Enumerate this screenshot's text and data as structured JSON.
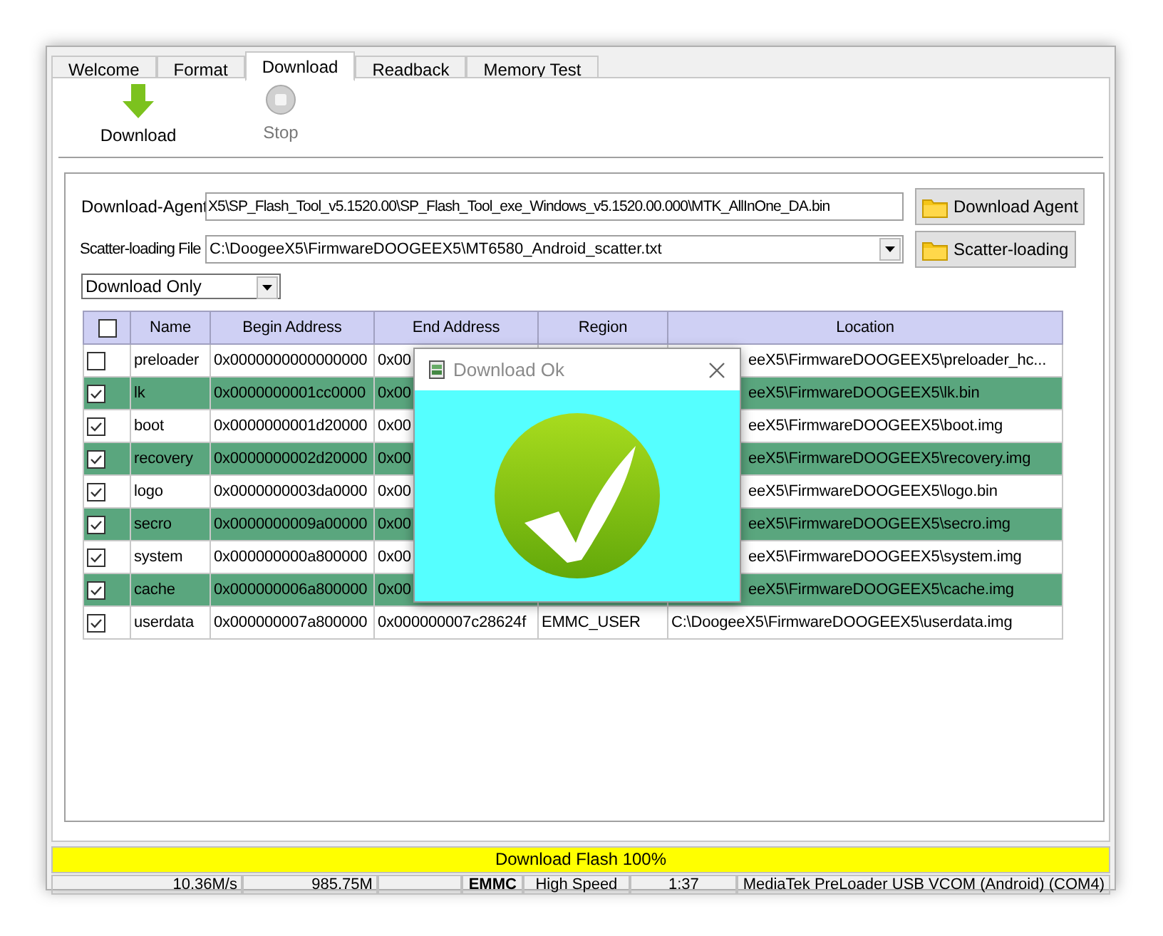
{
  "tabs": [
    {
      "label": "Welcome",
      "selected": false
    },
    {
      "label": "Format",
      "selected": false
    },
    {
      "label": "Download",
      "selected": true
    },
    {
      "label": "Readback",
      "selected": false
    },
    {
      "label": "Memory Test",
      "selected": false
    }
  ],
  "toolbar": [
    {
      "label": "Download",
      "disabled": false,
      "kind": "download"
    },
    {
      "label": "Stop",
      "disabled": true,
      "kind": "stop"
    }
  ],
  "download_agent": {
    "label": "Download-Agent",
    "value": "X5\\SP_Flash_Tool_v5.1520.00\\SP_Flash_Tool_exe_Windows_v5.1520.00.000\\MTK_AllInOne_DA.bin",
    "button": "Download Agent"
  },
  "scatter_file": {
    "label": "Scatter-loading File",
    "value": "C:\\DoogeeX5\\FirmwareDOOGEEX5\\MT6580_Android_scatter.txt",
    "button": "Scatter-loading"
  },
  "mode": {
    "value": "Download Only"
  },
  "table": {
    "header_checked": false,
    "columns": [
      "Name",
      "Begin Address",
      "End Address",
      "Region",
      "Location"
    ],
    "rows": [
      {
        "checked": false,
        "name": "preloader",
        "begin": "0x0000000000000000",
        "end": "0x00",
        "location": "eeX5\\FirmwareDOOGEEX5\\preloader_hc..."
      },
      {
        "checked": true,
        "name": "lk",
        "begin": "0x0000000001cc0000",
        "end": "0x00",
        "location": "eeX5\\FirmwareDOOGEEX5\\lk.bin"
      },
      {
        "checked": true,
        "name": "boot",
        "begin": "0x0000000001d20000",
        "end": "0x00",
        "location": "eeX5\\FirmwareDOOGEEX5\\boot.img"
      },
      {
        "checked": true,
        "name": "recovery",
        "begin": "0x0000000002d20000",
        "end": "0x00",
        "location": "eeX5\\FirmwareDOOGEEX5\\recovery.img"
      },
      {
        "checked": true,
        "name": "logo",
        "begin": "0x0000000003da0000",
        "end": "0x00",
        "location": "eeX5\\FirmwareDOOGEEX5\\logo.bin"
      },
      {
        "checked": true,
        "name": "secro",
        "begin": "0x0000000009a00000",
        "end": "0x00",
        "location": "eeX5\\FirmwareDOOGEEX5\\secro.img"
      },
      {
        "checked": true,
        "name": "system",
        "begin": "0x000000000a800000",
        "end": "0x00",
        "location": "eeX5\\FirmwareDOOGEEX5\\system.img"
      },
      {
        "checked": true,
        "name": "cache",
        "begin": "0x000000006a800000",
        "end": "0x00",
        "location": "eeX5\\FirmwareDOOGEEX5\\cache.img"
      },
      {
        "checked": true,
        "name": "userdata",
        "begin": "0x000000007a800000",
        "end": "0x000000007c28624f",
        "region": "EMMC_USER",
        "location": "C:\\DoogeeX5\\FirmwareDOOGEEX5\\userdata.img"
      }
    ]
  },
  "dialog": {
    "title": "Download Ok"
  },
  "progress": {
    "label": "Download Flash 100%",
    "level": 1
  },
  "status_bar": [
    "10.36M/s",
    "985.75M",
    "EMMC",
    "High Speed",
    "1:37",
    "MediaTek PreLoader USB VCOM (Android) (COM4)"
  ]
}
